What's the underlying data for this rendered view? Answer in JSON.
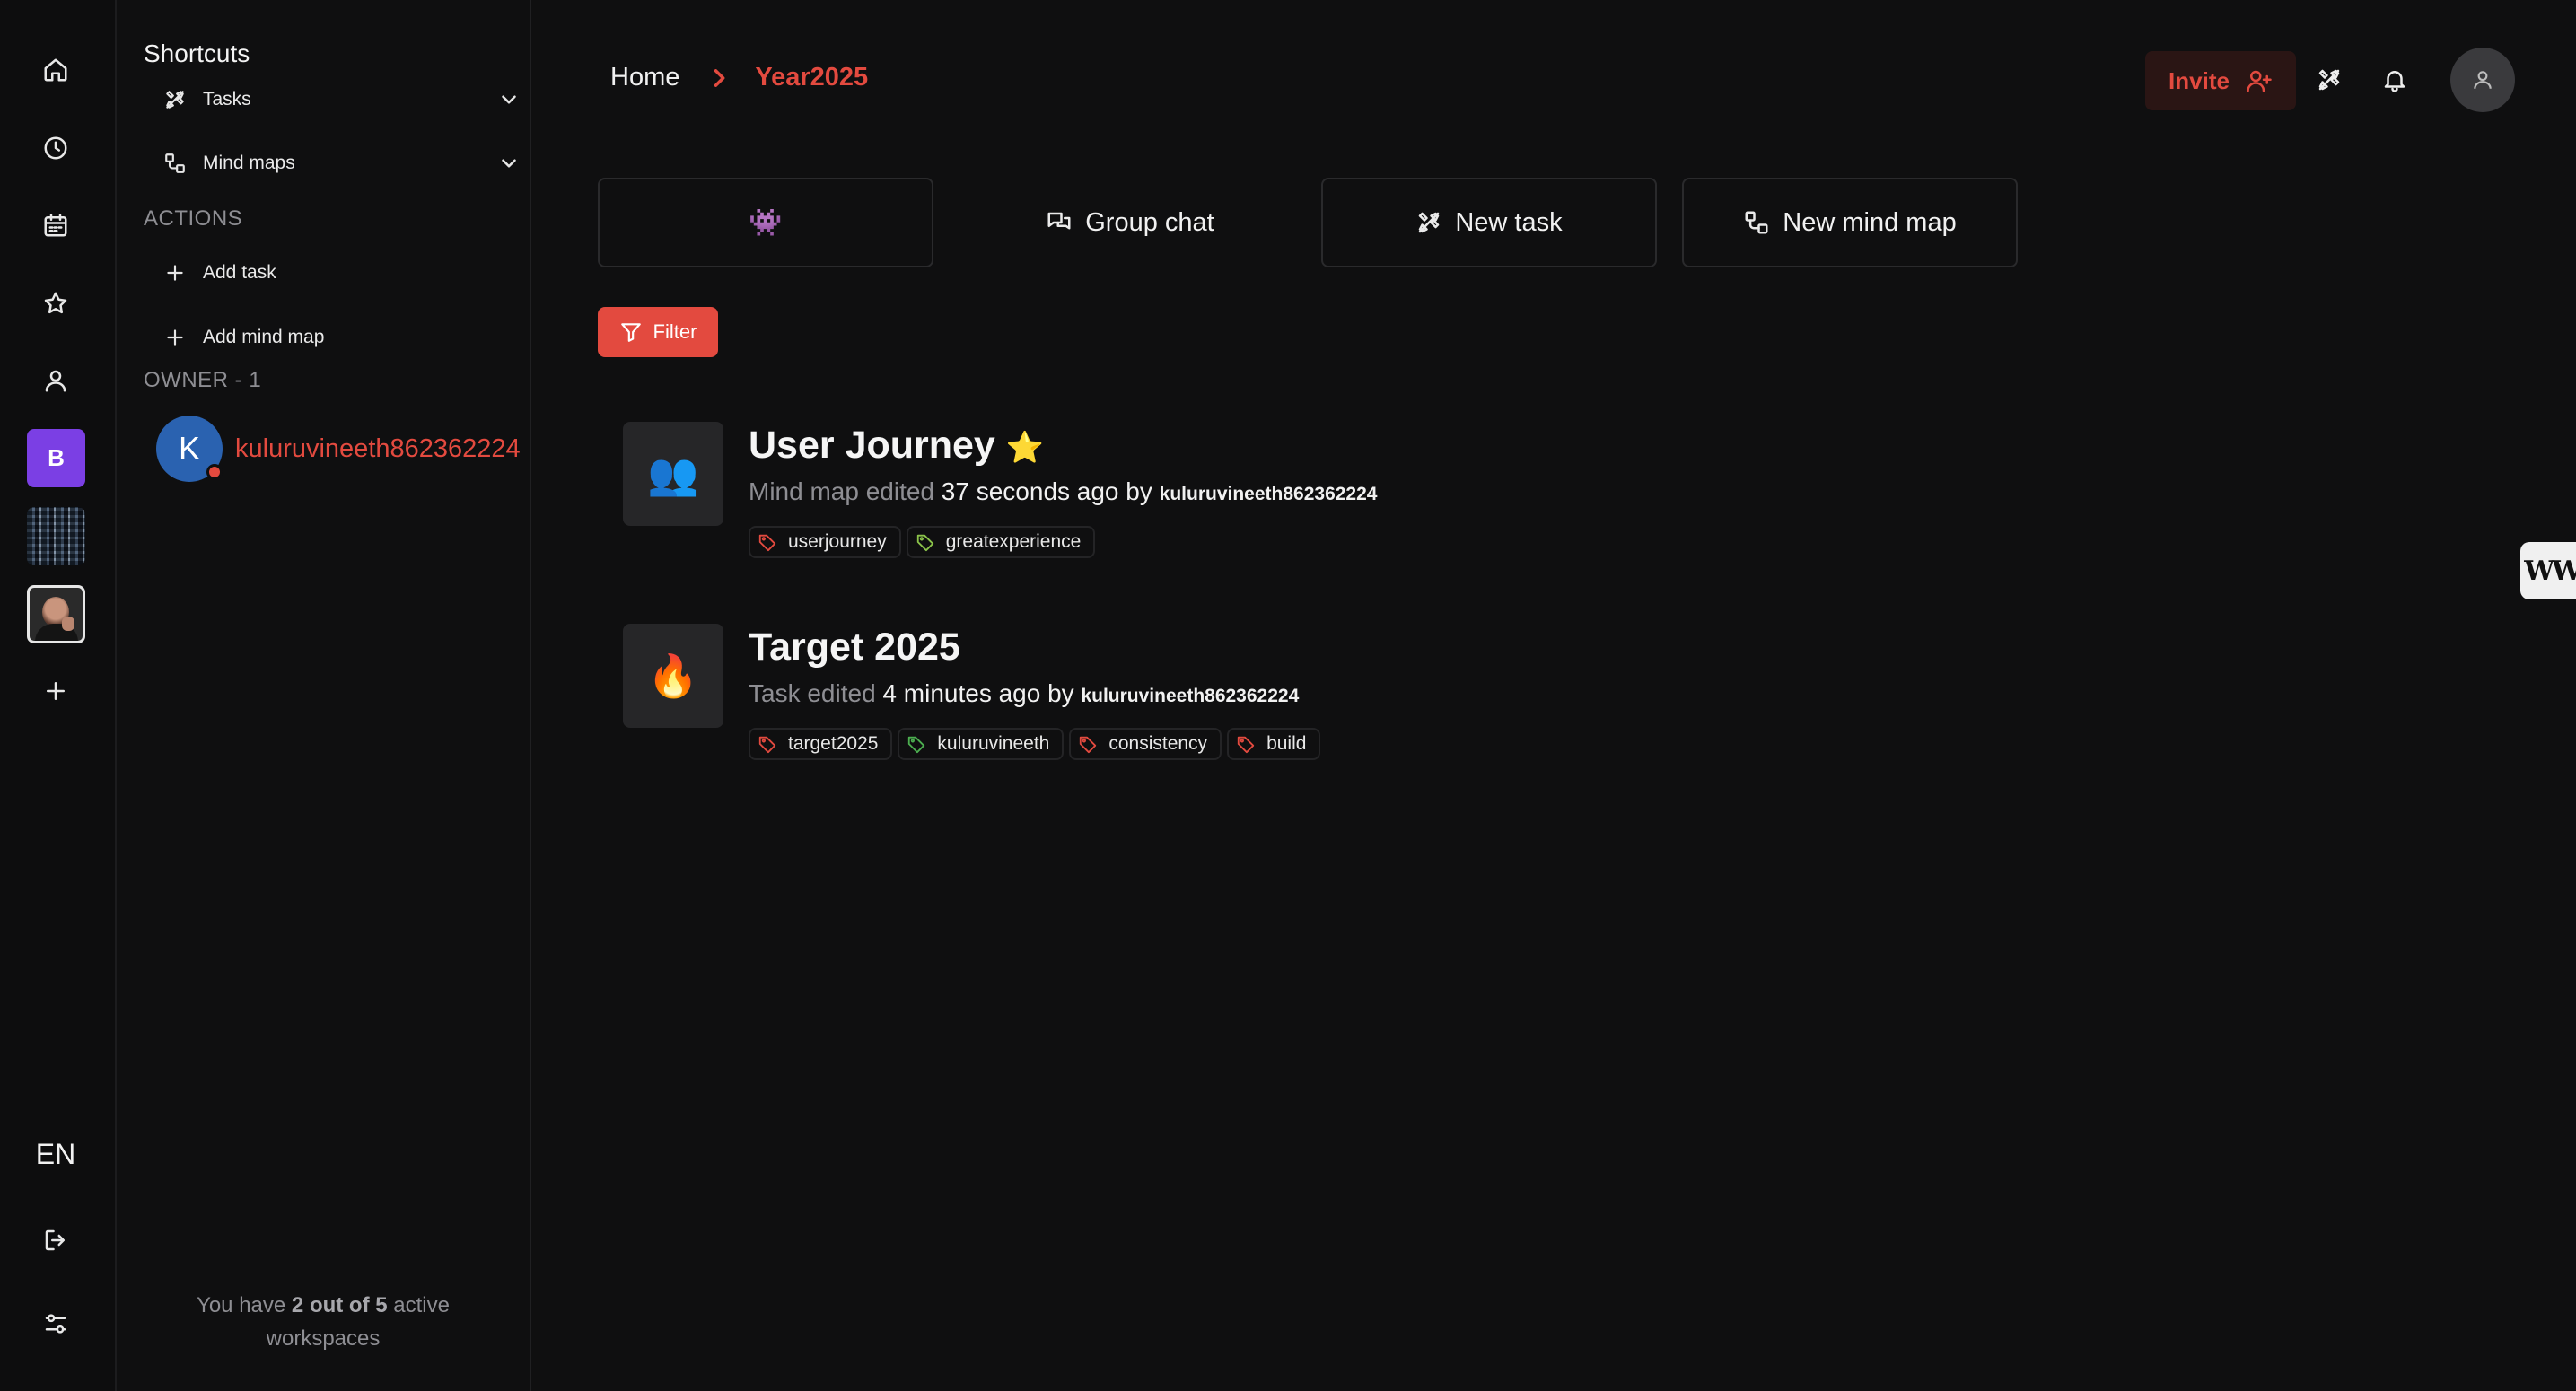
{
  "rail": {
    "language": "EN",
    "workspace_b_label": "B"
  },
  "sidebar": {
    "title": "Shortcuts",
    "shortcuts": [
      {
        "label": "Tasks",
        "icon": "tasks-icon"
      },
      {
        "label": "Mind maps",
        "icon": "mind-map-icon"
      }
    ],
    "actions_heading": "ACTIONS",
    "actions": [
      {
        "label": "Add task",
        "icon": "plus-icon"
      },
      {
        "label": "Add mind map",
        "icon": "plus-icon"
      }
    ],
    "owner_heading": "OWNER - 1",
    "owner": {
      "initial": "K",
      "name": "kuluruvineeth862362224"
    },
    "footer": {
      "prefix": "You have ",
      "count": "2 out of 5",
      "suffix": " active workspaces"
    }
  },
  "header": {
    "breadcrumb_home": "Home",
    "breadcrumb_current": "Year2025",
    "invite_label": "Invite"
  },
  "quick_actions": {
    "emoji": "👾",
    "group_chat": "Group chat",
    "new_task": "New task",
    "new_mind_map": "New mind map"
  },
  "filter_label": "Filter",
  "items": [
    {
      "emoji": "👥",
      "title": "User Journey",
      "starred": "⭐",
      "meta_type": "Mind map edited",
      "meta_time": "37 seconds ago",
      "meta_by": "by",
      "meta_user": "kuluruvineeth862362224",
      "tags": [
        {
          "label": "userjourney",
          "color": "#e34a3f"
        },
        {
          "label": "greatexperience",
          "color": "#8bc34a"
        }
      ]
    },
    {
      "emoji": "🔥",
      "title": "Target 2025",
      "meta_type": "Task edited",
      "meta_time": "4 minutes ago",
      "meta_by": "by",
      "meta_user": "kuluruvineeth862362224",
      "tags": [
        {
          "label": "target2025",
          "color": "#e34a3f"
        },
        {
          "label": "kuluruvineeth",
          "color": "#4caf50"
        },
        {
          "label": "consistency",
          "color": "#e34a3f"
        },
        {
          "label": "build",
          "color": "#e34a3f"
        }
      ]
    }
  ],
  "side_widget_label": "W",
  "colors": {
    "accent": "#e34a3f",
    "background": "#0f0f10",
    "workspace_b": "#7b3fe4",
    "owner_avatar": "#2a62b0"
  }
}
